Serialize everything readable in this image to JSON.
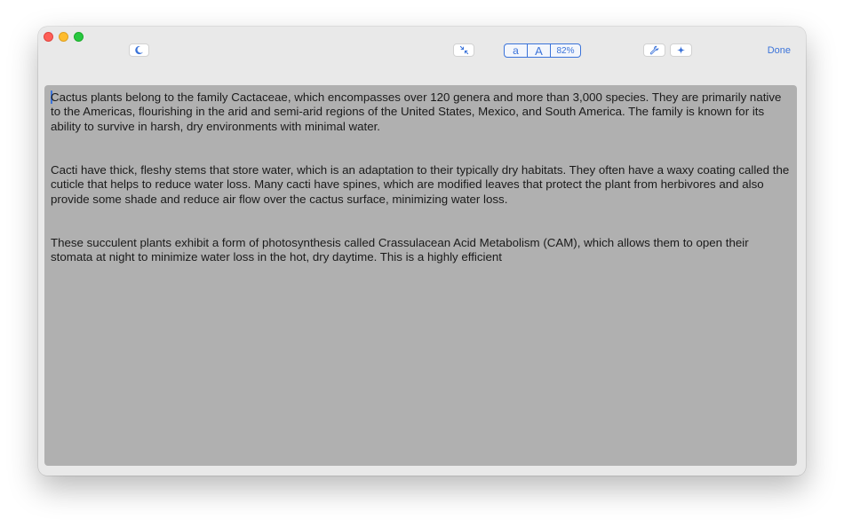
{
  "toolbar": {
    "segmented": {
      "small_font_label": "a",
      "large_font_label": "A",
      "zoom_label": "82%"
    },
    "done_label": "Done",
    "icons": {
      "theme": "moon-icon",
      "collapse": "arrows-collapse-icon",
      "tools": "wrench-icon",
      "add": "plus-icon"
    }
  },
  "editor": {
    "paragraphs": [
      "Cactus plants belong to the family Cactaceae, which encompasses over 120 genera and more than 3,000 species. They are primarily native to the Americas, flourishing in the arid and semi-arid regions of the United States, Mexico, and South America. The family is known for its ability to survive in harsh, dry environments with minimal water.",
      "Cacti have thick, fleshy stems that store water, which is an adaptation to their typically dry habitats. They often have a waxy coating called the cuticle that helps to reduce water loss. Many cacti have spines, which are modified leaves that protect the plant from herbivores and also provide some shade and reduce air flow over the cactus surface, minimizing water loss.",
      "These succulent plants exhibit a form of photosynthesis called Crassulacean Acid Metabolism (CAM), which allows them to open their stomata at night to minimize water loss in the hot, dry daytime. This is a highly efficient"
    ]
  },
  "colors": {
    "accent": "#3b73d9",
    "editor_background": "#b0b0b0",
    "window_background": "#e9e9e9"
  }
}
